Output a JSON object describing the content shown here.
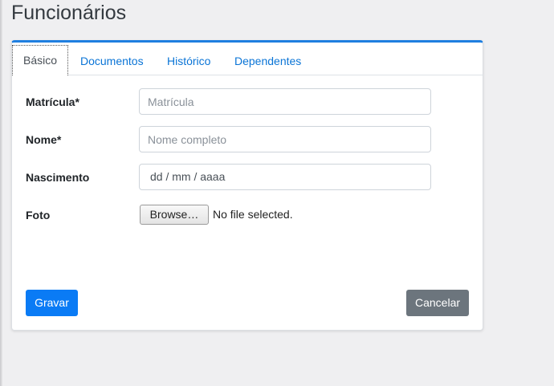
{
  "page": {
    "title": "Funcionários"
  },
  "tabs": [
    {
      "label": "Básico",
      "active": true
    },
    {
      "label": "Documentos",
      "active": false
    },
    {
      "label": "Histórico",
      "active": false
    },
    {
      "label": "Dependentes",
      "active": false
    }
  ],
  "form": {
    "matricula": {
      "label": "Matrícula*",
      "placeholder": "Matrícula",
      "value": ""
    },
    "nome": {
      "label": "Nome*",
      "placeholder": "Nome completo",
      "value": ""
    },
    "nascimento": {
      "label": "Nascimento",
      "placeholder": "dd / mm / aaaa"
    },
    "foto": {
      "label": "Foto",
      "browse_label": "Browse…",
      "status": "No file selected."
    }
  },
  "actions": {
    "save_label": "Gravar",
    "cancel_label": "Cancelar"
  },
  "colors": {
    "accent": "#1f7fe0",
    "primary": "#0a7bf5",
    "secondary": "#6c757d",
    "link": "#0a74d6"
  }
}
